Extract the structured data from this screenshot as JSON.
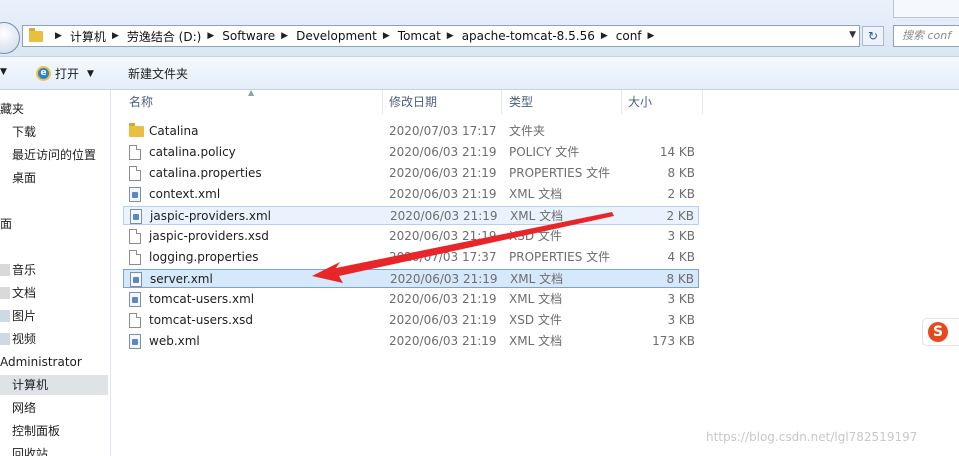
{
  "address_bar": {
    "crumbs": [
      "计算机",
      "劳逸结合 (D:)",
      "Software",
      "Development",
      "Tomcat",
      "apache-tomcat-8.5.56",
      "conf"
    ],
    "search_placeholder": "搜索 conf"
  },
  "toolbar": {
    "open_label": "打开",
    "new_folder_label": "新建文件夹"
  },
  "nav": {
    "items": [
      "收藏夹",
      "下载",
      "最近访问的位置",
      "桌面",
      "桌面",
      "库",
      "音乐",
      "文档",
      "图片",
      "视频",
      "Administrator",
      "计算机",
      "网络",
      "控制面板",
      "回收站"
    ]
  },
  "columns": {
    "name": "名称",
    "date": "修改日期",
    "type": "类型",
    "size": "大小"
  },
  "files": [
    {
      "name": "Catalina",
      "date": "2020/07/03 17:17",
      "type": "文件夹",
      "size": "",
      "icon": "folder-icon"
    },
    {
      "name": "catalina.policy",
      "date": "2020/06/03 21:19",
      "type": "POLICY 文件",
      "size": "14 KB",
      "icon": "document-icon"
    },
    {
      "name": "catalina.properties",
      "date": "2020/06/03 21:19",
      "type": "PROPERTIES 文件",
      "size": "8 KB",
      "icon": "document-icon"
    },
    {
      "name": "context.xml",
      "date": "2020/06/03 21:19",
      "type": "XML 文档",
      "size": "2 KB",
      "icon": "xml-file-icon"
    },
    {
      "name": "jaspic-providers.xml",
      "date": "2020/06/03 21:19",
      "type": "XML 文档",
      "size": "2 KB",
      "icon": "xml-file-icon"
    },
    {
      "name": "jaspic-providers.xsd",
      "date": "2020/06/03 21:19",
      "type": "XSD 文件",
      "size": "3 KB",
      "icon": "document-icon"
    },
    {
      "name": "logging.properties",
      "date": "2020/07/03 17:37",
      "type": "PROPERTIES 文件",
      "size": "4 KB",
      "icon": "document-icon"
    },
    {
      "name": "server.xml",
      "date": "2020/06/03 21:19",
      "type": "XML 文档",
      "size": "8 KB",
      "icon": "xml-file-icon"
    },
    {
      "name": "tomcat-users.xml",
      "date": "2020/06/03 21:19",
      "type": "XML 文档",
      "size": "3 KB",
      "icon": "xml-file-icon"
    },
    {
      "name": "tomcat-users.xsd",
      "date": "2020/06/03 21:19",
      "type": "XSD 文件",
      "size": "3 KB",
      "icon": "document-icon"
    },
    {
      "name": "web.xml",
      "date": "2020/06/03 21:19",
      "type": "XML 文档",
      "size": "173 KB",
      "icon": "xml-file-icon"
    }
  ],
  "overlays": {
    "arrow_color": "#e8262a",
    "ime_logo": "S",
    "watermark": "https://blog.csdn.net/lgl782519197"
  }
}
